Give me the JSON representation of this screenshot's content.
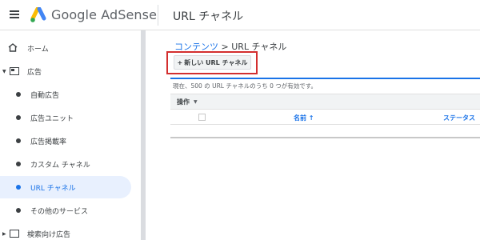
{
  "header": {
    "app_name": "Google AdSense",
    "page_title": "URL チャネル"
  },
  "sidebar": {
    "items": [
      {
        "label": "ホーム",
        "icon": "home-icon"
      },
      {
        "label": "広告",
        "icon": "ads-icon"
      },
      {
        "label": "自動広告"
      },
      {
        "label": "広告ユニット"
      },
      {
        "label": "広告掲載率"
      },
      {
        "label": "カスタム チャネル"
      },
      {
        "label": "URL チャネル",
        "active": true
      },
      {
        "label": "その他のサービス"
      },
      {
        "label": "検索向け広告",
        "icon": "search-ad-icon"
      }
    ]
  },
  "main": {
    "breadcrumb_parent": "コンテンツ",
    "breadcrumb_separator": " > ",
    "breadcrumb_current": "URL チャネル",
    "new_button_icon": "+",
    "new_button_label": "新しい URL チャネル",
    "status_text": "現在、500 の URL チャネルのうち 0 つが有効です。",
    "operations_label": "操作",
    "operations_chevron": "▼",
    "columns": {
      "name": "名前 ↑",
      "status": "ステータス"
    }
  },
  "colors": {
    "accent": "#1a73e8",
    "highlight": "#d32f2f",
    "active_bg": "#e8f0fe"
  }
}
